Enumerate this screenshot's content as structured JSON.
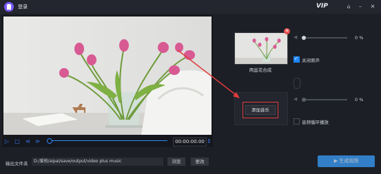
{
  "titlebar": {
    "title": "登录",
    "vip": "VIP"
  },
  "player": {
    "time": "00:00:00:00"
  },
  "right": {
    "thumb_label": "两盆花合成",
    "volume1_pct": "0 %",
    "mute_label": "关闭原声",
    "mute_checked": true,
    "add_music_label": "添加音乐",
    "volume2_pct": "0 %",
    "loop_label": "音频循环播放",
    "loop_checked": false
  },
  "bottom": {
    "output_label": "输出文件夹",
    "output_path": "D:/爱拍/aipai/save/output/video plus music",
    "browse_label": "浏览",
    "change_label": "更改",
    "generate_label": "生成视频"
  },
  "colors": {
    "accent": "#1e88ff",
    "highlight": "#e23b3b"
  }
}
